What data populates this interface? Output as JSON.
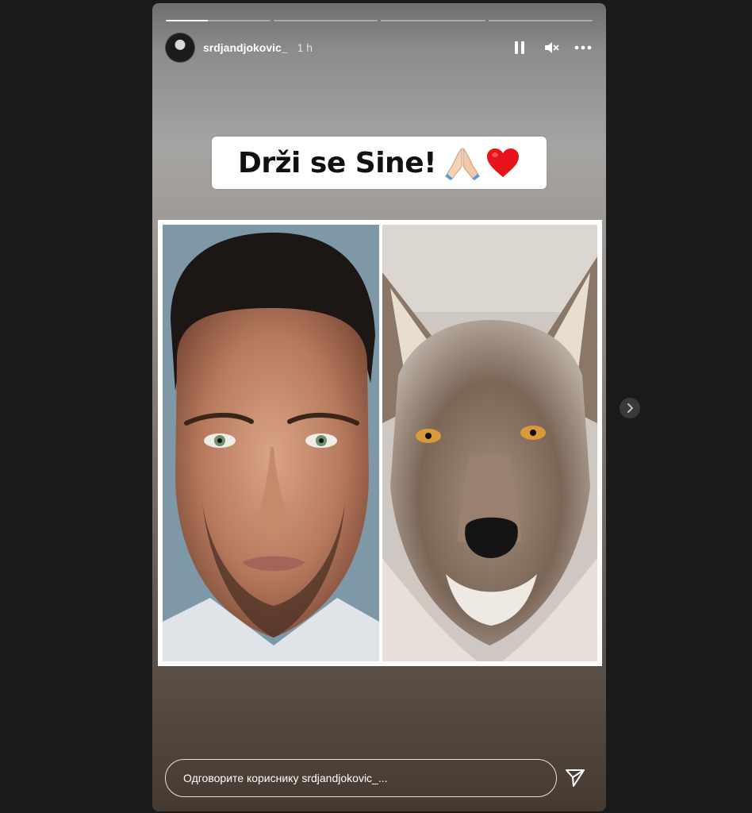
{
  "story": {
    "progress": [
      0.4,
      0,
      0,
      0
    ],
    "username": "srdjandjokovic_",
    "time": "1 h",
    "caption": "Drži se Sine!",
    "caption_emojis": [
      "praying-hands-emoji",
      "red-heart-emoji"
    ],
    "reply_placeholder": "Одговорите кориснику srdjandjokovic_...",
    "icons": {
      "pause": "pause-icon",
      "mute": "speaker-muted-icon",
      "more": "more-dots-icon",
      "send": "send-icon",
      "next": "chevron-right-icon"
    }
  },
  "colors": {
    "page_background": "#1a1a1a",
    "caption_background": "#ffffff",
    "text": "#ffffff"
  }
}
